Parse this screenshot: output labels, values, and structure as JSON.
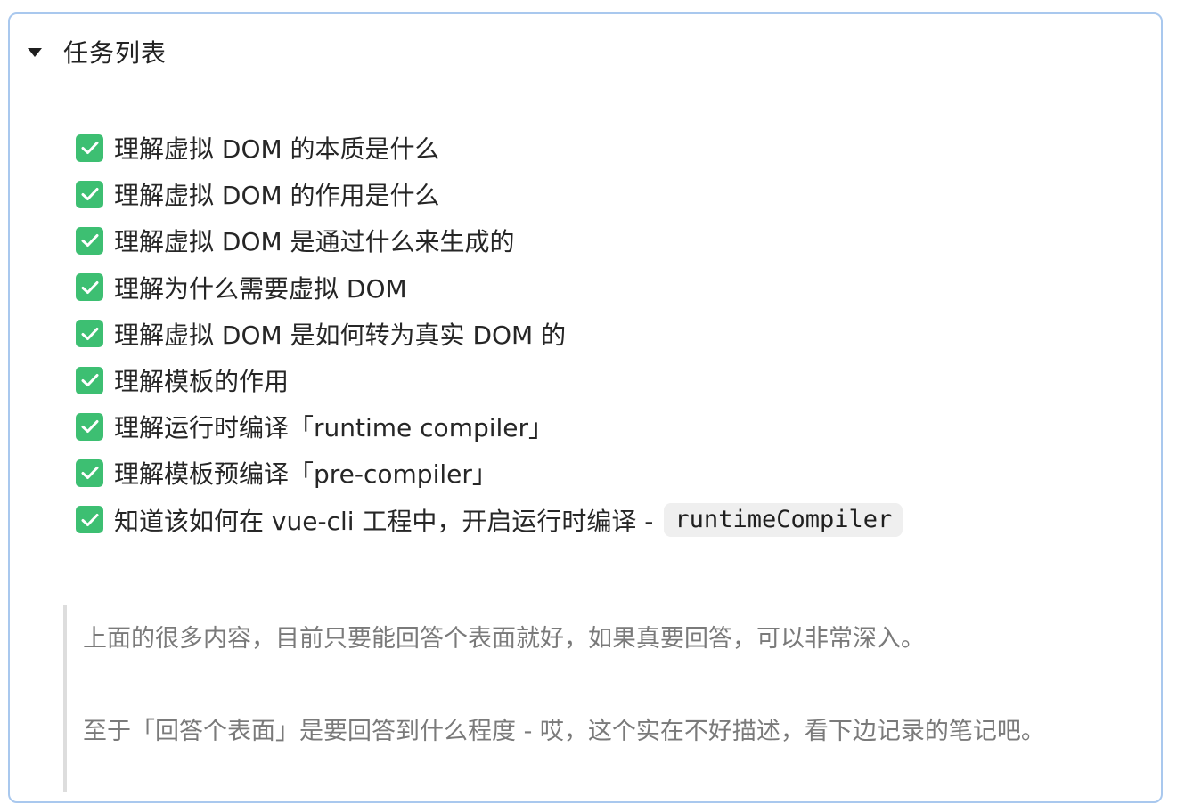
{
  "details": {
    "summary": "任务列表"
  },
  "tasks": [
    {
      "text": "理解虚拟 DOM 的本质是什么",
      "checked": true
    },
    {
      "text": "理解虚拟 DOM 的作用是什么",
      "checked": true
    },
    {
      "text": "理解虚拟 DOM 是通过什么来生成的",
      "checked": true
    },
    {
      "text": "理解为什么需要虚拟 DOM",
      "checked": true
    },
    {
      "text": "理解虚拟 DOM 是如何转为真实 DOM 的",
      "checked": true
    },
    {
      "text": "理解模板的作用",
      "checked": true
    },
    {
      "text": "理解运行时编译「runtime compiler」",
      "checked": true
    },
    {
      "text": "理解模板预编译「pre-compiler」",
      "checked": true
    },
    {
      "text": "知道该如何在 vue-cli 工程中，开启运行时编译 -",
      "code": "runtimeCompiler",
      "checked": true
    }
  ],
  "quote": {
    "p1": "上面的很多内容，目前只要能回答个表面就好，如果真要回答，可以非常深入。",
    "p2": "至于「回答个表面」是要回答到什么程度 - 哎，这个实在不好描述，看下边记录的笔记吧。"
  },
  "colors": {
    "border": "#a9c8ee",
    "check": "#3dbf72",
    "quote_bar": "#dddddd",
    "quote_text": "#7a7a7a"
  },
  "icons": {
    "toggle": "caret-down-icon",
    "check": "checkbox-checked-icon"
  }
}
